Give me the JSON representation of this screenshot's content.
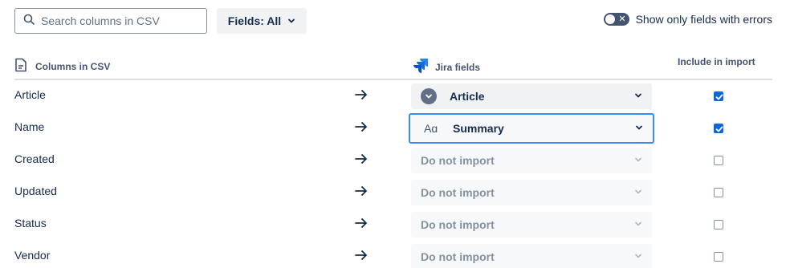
{
  "toolbar": {
    "search_placeholder": "Search columns in CSV",
    "fields_filter_label": "Fields: All",
    "toggle_label": "Show only fields with errors"
  },
  "header": {
    "csv_columns": "Columns in CSV",
    "jira_fields": "Jira fields",
    "include": "Include in import"
  },
  "rows": [
    {
      "column": "Article",
      "field": "Article",
      "field_icon": "chevron-down-circle-icon",
      "included": true,
      "state": "mapped"
    },
    {
      "column": "Name",
      "field": "Summary",
      "field_icon": "text-aa-icon",
      "included": true,
      "state": "focused"
    },
    {
      "column": "Created",
      "field": "Do not import",
      "included": false,
      "state": "unmapped"
    },
    {
      "column": "Updated",
      "field": "Do not import",
      "included": false,
      "state": "unmapped"
    },
    {
      "column": "Status",
      "field": "Do not import",
      "included": false,
      "state": "unmapped"
    },
    {
      "column": "Vendor",
      "field": "Do not import",
      "included": false,
      "state": "unmapped"
    }
  ],
  "colors": {
    "accent": "#0c66e4",
    "focus_border": "#388bff",
    "text": "#172b4d",
    "muted": "#8590a2"
  }
}
